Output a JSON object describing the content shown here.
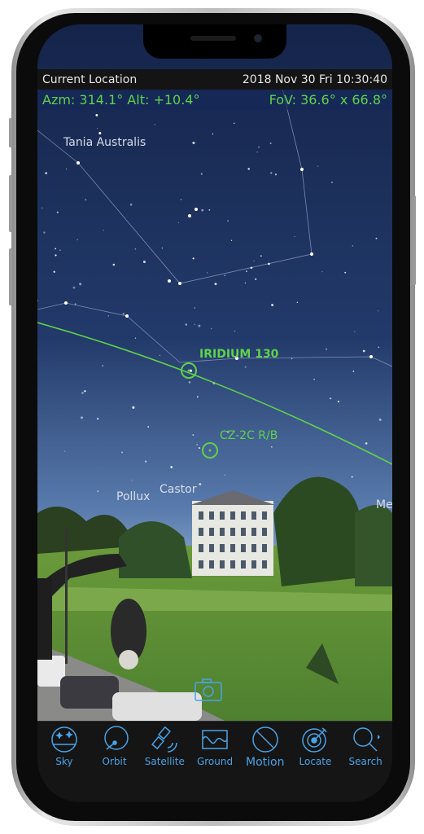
{
  "status_bar": {
    "location": "Current Location",
    "datetime": "2018 Nov 30 Fri 10:30:40"
  },
  "info_bar": {
    "position": "Azm: 314.1° Alt: +10.4°",
    "fov": "FoV: 36.6° x 66.8°"
  },
  "sky_labels": {
    "star_1": "Tania Australis",
    "star_2": "Pollux",
    "star_3": "Castor",
    "star_4": "Me"
  },
  "satellites": [
    {
      "name": "IRIDIUM 130",
      "icon": "target-circle-icon"
    },
    {
      "name": "CZ-2C R/B",
      "icon": "target-circle-icon"
    }
  ],
  "camera_icon": "camera-icon",
  "toolbar": [
    {
      "label": "Sky",
      "icon": "sky-dome-icon"
    },
    {
      "label": "Orbit",
      "icon": "orbit-icon"
    },
    {
      "label": "Satellite",
      "icon": "satellite-icon"
    },
    {
      "label": "Ground",
      "icon": "ground-track-icon"
    },
    {
      "label": "Motion",
      "icon": "no-motion-icon"
    },
    {
      "label": "Locate",
      "icon": "target-dart-icon"
    },
    {
      "label": "Search",
      "icon": "search-icon"
    }
  ],
  "colors": {
    "accent_green": "#5fd24a",
    "toolbar_blue": "#4aa3e8",
    "sky_top": "#15244a",
    "sky_horizon": "#5a7cae"
  }
}
